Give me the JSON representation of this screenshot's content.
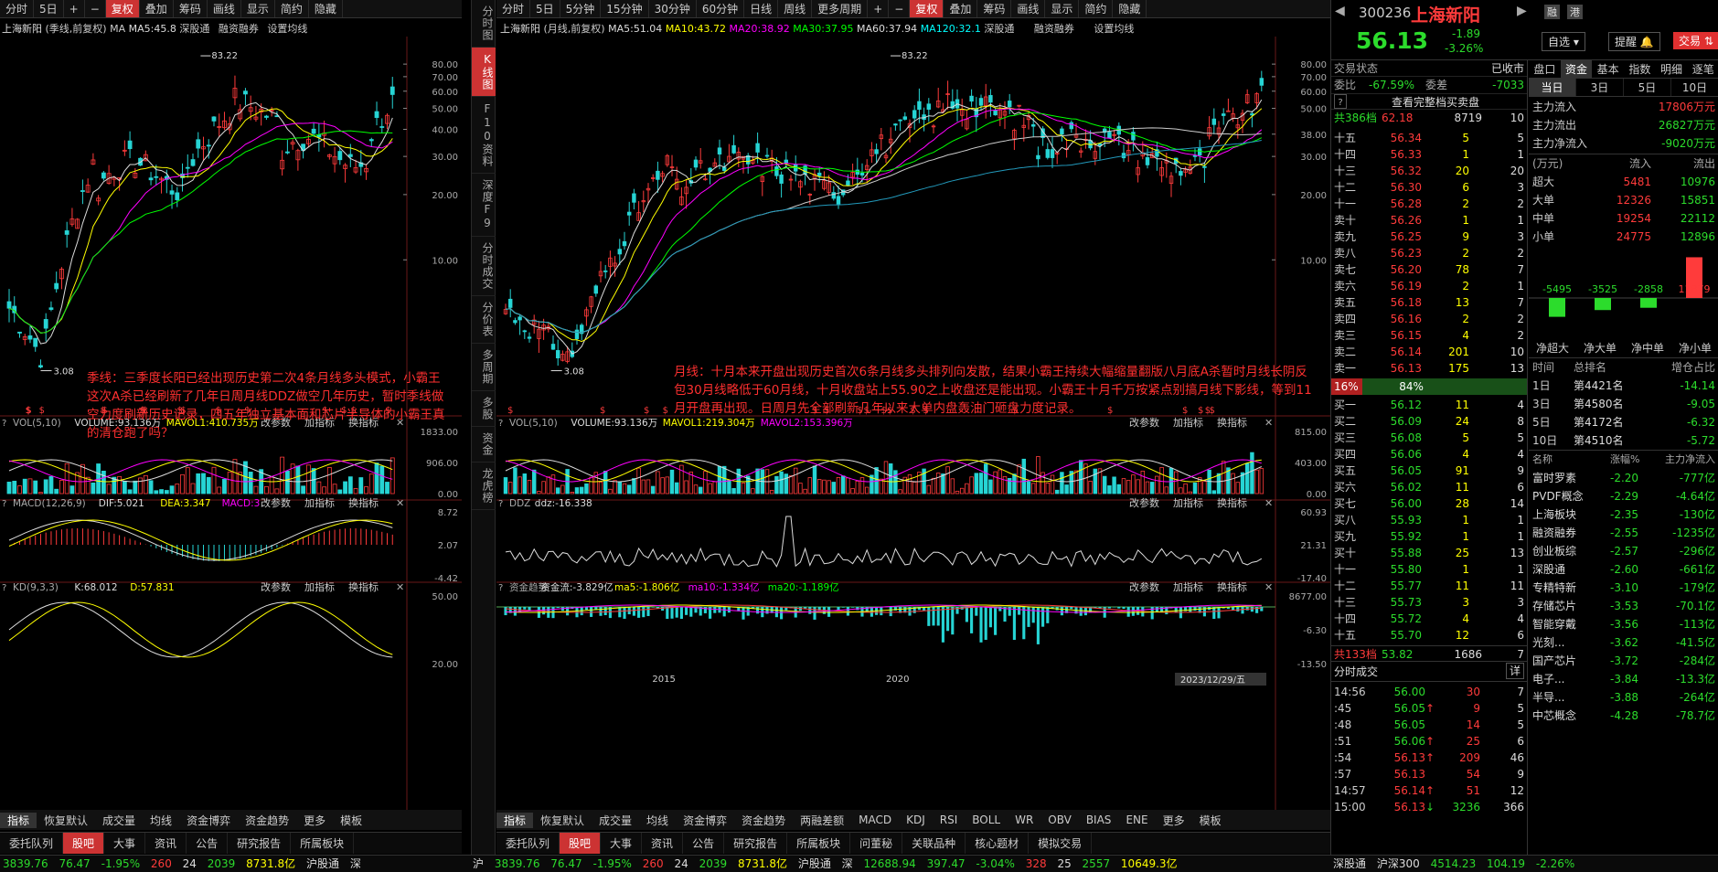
{
  "left_chart": {
    "toolbar": [
      "分时",
      "5日",
      "+",
      "−",
      "复权",
      "叠加",
      "筹码",
      "画线",
      "显示",
      "简约",
      "隐藏"
    ],
    "toolbar_active": "复权",
    "title": "上海新阳",
    "period": "(季线,前复权)",
    "ma_label": "MA",
    "ma5": "MA5:45.8",
    "extra": "深股通",
    "btn1": "融资融券",
    "btn2": "设置均线",
    "price_axis": [
      "80.00",
      "70.00",
      "60.00",
      "50.00",
      "40.00",
      "30.00",
      "20.00",
      "10.00"
    ],
    "high_label": "83.22",
    "low_label": "3.08",
    "annotation": "季线：三季度长阳已经出现历史第二次4条月线多头模式，小霸王这次A杀已经刷新了几年日周月线DDZ做空几年历史，暂时季线做空力度刷新历史记录，四五年独立基本面和芯片半导体的小霸王真的清仓跑了吗？",
    "vol_label": "VOL(5,10)",
    "vol_value": "VOLUME:93.136万",
    "vol_mavol1": "MAVOL1:410.735万",
    "vol_axis": [
      "1833.00",
      "906.00",
      "0.00"
    ],
    "macd_label": "MACD(12,26,9)",
    "macd_dif": "DIF:5.021",
    "macd_dea": "DEA:3.347",
    "macd_macd": "MACD:3",
    "macd_axis": [
      "8.72",
      "2.07",
      "-4.42"
    ],
    "kd_label": "KD(9,3,3)",
    "kd_k": "K:68.012",
    "kd_d": "D:57.831",
    "kd_axis": [
      "50.00",
      "20.00"
    ],
    "pane_btns": [
      "改参数",
      "加指标",
      "换指标"
    ],
    "bottom_tabs": [
      "指标",
      "恢复默认",
      "成交量",
      "均线",
      "资金博弈",
      "资金趋势",
      "更多",
      "模板"
    ],
    "bottom_tabs2": [
      "委托队列",
      "股吧",
      "大事",
      "资讯",
      "公告",
      "研究报告",
      "所属板块"
    ]
  },
  "vnav": [
    "分时图",
    "K线图",
    "F10资料",
    "深度F9",
    "分时成交",
    "分价表",
    "多周期",
    "多股",
    "资金",
    "龙虎榜"
  ],
  "vnav_active": "K线图",
  "mid_chart": {
    "toolbar": [
      "分时",
      "5日",
      "5分钟",
      "15分钟",
      "30分钟",
      "60分钟",
      "日线",
      "周线",
      "更多周期",
      "+",
      "−",
      "复权",
      "叠加",
      "筹码",
      "画线",
      "显示",
      "简约",
      "隐藏"
    ],
    "toolbar_active": "复权",
    "title": "上海新阳",
    "period": "(月线,前复权)",
    "ma5": "MA5:51.04",
    "ma10": "MA10:43.72",
    "ma20": "MA20:38.92",
    "ma30": "MA30:37.95",
    "ma60": "MA60:37.94",
    "ma120": "MA120:32.1",
    "extra": "深股通",
    "btn1": "融资融券",
    "btn2": "设置均线",
    "price_axis": [
      "80.00",
      "70.00",
      "60.00",
      "50.00",
      "38.00",
      "30.00",
      "20.00",
      "10.00"
    ],
    "high_label": "83.22",
    "low_label": "3.08",
    "annotation": "月线：十月本来开盘出现历史首次6条月线多头排列向发散，结果小霸王持续大幅缩量翻版八月底A杀暂时月线长阴反包30月线略低于60月线，十月收盘站上55.90之上收盘还是能出现。小霸王十月千万按紧点别搞月线下影线，等到11月开盘再出现。日周月先全部刷新几年以来大单内盘轰油门砸盘力度记录。",
    "vol_label": "VOL(5,10)",
    "vol_value": "VOLUME:93.136万",
    "vol_mavol1": "MAVOL1:219.304万",
    "vol_mavol2": "MAVOL2:153.396万",
    "vol_axis": [
      "815.00",
      "403.00",
      "0.00"
    ],
    "ddz_label": "DDZ",
    "ddz_value": "ddz:-16.338",
    "ddz_axis": [
      "60.93",
      "21.31",
      "-17.40"
    ],
    "fund_label": "资金趋势",
    "fund_value": "资金流:-3.829亿",
    "fund_ma5": "ma5:-1.806亿",
    "fund_ma10": "ma10:-1.334亿",
    "fund_ma20": "ma20:-1.189亿",
    "fund_axis": [
      "8677.00",
      "-6.30",
      "-13.50"
    ],
    "x_labels": [
      "2015",
      "2020"
    ],
    "date_box": "2023/12/29/五",
    "pane_btns": [
      "改参数",
      "加指标",
      "换指标"
    ],
    "bottom_tabs": [
      "指标",
      "恢复默认",
      "成交量",
      "均线",
      "资金博弈",
      "资金趋势",
      "两融差额",
      "MACD",
      "KDJ",
      "RSI",
      "BOLL",
      "WR",
      "OBV",
      "BIAS",
      "ENE",
      "更多",
      "模板"
    ],
    "bottom_tabs2": [
      "委托队列",
      "股吧",
      "大事",
      "资讯",
      "公告",
      "研究报告",
      "所属板块",
      "问董秘",
      "关联品种",
      "核心题材",
      "模拟交易"
    ]
  },
  "right_panel": {
    "code": "300236",
    "name": "上海新阳",
    "badge1": "融",
    "badge2": "港",
    "price": "56.13",
    "change": "-1.89",
    "change_pct": "-3.26%",
    "btn_watch": "自选",
    "btn_alert": "提醒",
    "btn_trade": "交易",
    "trade_status_label": "交易状态",
    "trade_status": "已收市",
    "weibi_label": "委比",
    "weibi": "-67.59%",
    "weicha_label": "委差",
    "weicha": "-7033",
    "full_book": "查看完整档买卖盘",
    "sell_total_label": "共386档",
    "sell_total_price": "62.18",
    "sell_total_vol": "8719",
    "sell_total_cnt": "10",
    "sells": [
      {
        "l": "十五",
        "p": "56.34",
        "v": "5",
        "c": "5"
      },
      {
        "l": "十四",
        "p": "56.33",
        "v": "1",
        "c": "1"
      },
      {
        "l": "十三",
        "p": "56.32",
        "v": "20",
        "c": "20"
      },
      {
        "l": "十二",
        "p": "56.30",
        "v": "6",
        "c": "3"
      },
      {
        "l": "十一",
        "p": "56.28",
        "v": "2",
        "c": "2"
      },
      {
        "l": "卖十",
        "p": "56.26",
        "v": "1",
        "c": "1"
      },
      {
        "l": "卖九",
        "p": "56.25",
        "v": "9",
        "c": "3"
      },
      {
        "l": "卖八",
        "p": "56.23",
        "v": "2",
        "c": "2"
      },
      {
        "l": "卖七",
        "p": "56.20",
        "v": "78",
        "c": "7"
      },
      {
        "l": "卖六",
        "p": "56.19",
        "v": "2",
        "c": "1"
      },
      {
        "l": "卖五",
        "p": "56.18",
        "v": "13",
        "c": "7"
      },
      {
        "l": "卖四",
        "p": "56.16",
        "v": "2",
        "c": "2"
      },
      {
        "l": "卖三",
        "p": "56.15",
        "v": "4",
        "c": "2"
      },
      {
        "l": "卖二",
        "p": "56.14",
        "v": "201",
        "c": "10"
      },
      {
        "l": "卖一",
        "p": "56.13",
        "v": "175",
        "c": "13"
      }
    ],
    "ratio_left": "16%",
    "ratio_right": "84%",
    "buys": [
      {
        "l": "买一",
        "p": "56.12",
        "v": "11",
        "c": "4"
      },
      {
        "l": "买二",
        "p": "56.09",
        "v": "24",
        "c": "8"
      },
      {
        "l": "买三",
        "p": "56.08",
        "v": "5",
        "c": "5"
      },
      {
        "l": "买四",
        "p": "56.06",
        "v": "4",
        "c": "4"
      },
      {
        "l": "买五",
        "p": "56.05",
        "v": "91",
        "c": "9"
      },
      {
        "l": "买六",
        "p": "56.02",
        "v": "11",
        "c": "6"
      },
      {
        "l": "买七",
        "p": "56.00",
        "v": "28",
        "c": "14"
      },
      {
        "l": "买八",
        "p": "55.93",
        "v": "1",
        "c": "1"
      },
      {
        "l": "买九",
        "p": "55.92",
        "v": "1",
        "c": "1"
      },
      {
        "l": "买十",
        "p": "55.88",
        "v": "25",
        "c": "13"
      },
      {
        "l": "十一",
        "p": "55.80",
        "v": "1",
        "c": "1"
      },
      {
        "l": "十二",
        "p": "55.77",
        "v": "11",
        "c": "11"
      },
      {
        "l": "十三",
        "p": "55.73",
        "v": "3",
        "c": "3"
      },
      {
        "l": "十四",
        "p": "55.72",
        "v": "4",
        "c": "4"
      },
      {
        "l": "十五",
        "p": "55.70",
        "v": "12",
        "c": "6"
      }
    ],
    "buy_total_label": "共133档",
    "buy_total_price": "53.82",
    "buy_total_vol": "1686",
    "buy_total_cnt": "7",
    "ticks_title": "分时成交",
    "ticks_more": "详",
    "ticks": [
      {
        "t": "14:56",
        "p": "56.00",
        "v": "30",
        "n": "7",
        "d": ""
      },
      {
        "t": ":45",
        "p": "56.05",
        "v": "9",
        "n": "5",
        "d": "↑"
      },
      {
        "t": ":48",
        "p": "56.05",
        "v": "14",
        "n": "5",
        "d": ""
      },
      {
        "t": ":51",
        "p": "56.06",
        "v": "25",
        "n": "6",
        "d": "↑"
      },
      {
        "t": ":54",
        "p": "56.13",
        "v": "209",
        "n": "46",
        "d": "↑"
      },
      {
        "t": ":57",
        "p": "56.13",
        "v": "54",
        "n": "9",
        "d": ""
      },
      {
        "t": "14:57",
        "p": "56.14",
        "v": "51",
        "n": "12",
        "d": "↑"
      },
      {
        "t": "15:00",
        "p": "56.13",
        "v": "3236",
        "n": "366",
        "d": "↓"
      }
    ],
    "tabs": [
      "盘口",
      "资金",
      "基本",
      "指数",
      "明细",
      "逐笔"
    ],
    "tabs_active": "资金",
    "period_tabs": [
      "当日",
      "3日",
      "5日",
      "10日"
    ],
    "main_in_label": "主力流入",
    "main_in": "17806万元",
    "main_out_label": "主力流出",
    "main_out": "26827万元",
    "main_net_label": "主力净流入",
    "main_net": "-9020万元",
    "flow_head": [
      "(万元)",
      "流入",
      "流出"
    ],
    "flows": [
      {
        "n": "超大",
        "i": "5481",
        "o": "10976"
      },
      {
        "n": "大单",
        "i": "12326",
        "o": "15851"
      },
      {
        "n": "中单",
        "i": "19254",
        "o": "22112"
      },
      {
        "n": "小单",
        "i": "24775",
        "o": "12896"
      }
    ],
    "net_bars": [
      {
        "label": "净超大",
        "value": "-5495",
        "num": -5495
      },
      {
        "label": "净大单",
        "value": "-3525",
        "num": -3525
      },
      {
        "label": "净中单",
        "value": "-2858",
        "num": -2858
      },
      {
        "label": "净小单",
        "value": "11879",
        "num": 11879
      }
    ],
    "rank_head": [
      "时间",
      "总排名",
      "增仓占比"
    ],
    "ranks": [
      {
        "t": "1日",
        "r": "第4421名",
        "v": "-14.14"
      },
      {
        "t": "3日",
        "r": "第4580名",
        "v": "-9.05"
      },
      {
        "t": "5日",
        "r": "第4172名",
        "v": "-6.32"
      },
      {
        "t": "10日",
        "r": "第4510名",
        "v": "-5.72"
      }
    ],
    "sector_head": [
      "名称",
      "涨幅%",
      "主力净流入"
    ],
    "sectors": [
      {
        "n": "富时罗素",
        "p": "-2.20",
        "v": "-777亿"
      },
      {
        "n": "PVDF概念",
        "p": "-2.29",
        "v": "-4.64亿"
      },
      {
        "n": "上海板块",
        "p": "-2.35",
        "v": "-130亿"
      },
      {
        "n": "融资融券",
        "p": "-2.55",
        "v": "-1235亿"
      },
      {
        "n": "创业板综",
        "p": "-2.57",
        "v": "-296亿"
      },
      {
        "n": "深股通",
        "p": "-2.60",
        "v": "-661亿"
      },
      {
        "n": "专精特新",
        "p": "-3.10",
        "v": "-179亿"
      },
      {
        "n": "存储芯片",
        "p": "-3.53",
        "v": "-70.1亿"
      },
      {
        "n": "智能穿戴",
        "p": "-3.56",
        "v": "-113亿"
      },
      {
        "n": "光刻...",
        "p": "-3.62",
        "v": "-41.5亿"
      },
      {
        "n": "国产芯片",
        "p": "-3.72",
        "v": "-284亿"
      },
      {
        "n": "电子...",
        "p": "-3.84",
        "v": "-13.3亿"
      },
      {
        "n": "半导...",
        "p": "-3.88",
        "v": "-264亿"
      },
      {
        "n": "中芯概念",
        "p": "-4.28",
        "v": "-78.7亿"
      }
    ]
  },
  "status_bar": {
    "s1": "3839.76",
    "s2": "76.47",
    "s3": "-1.95%",
    "s4": "260",
    "s5": "24",
    "s6": "2039",
    "s7": "8731.8亿",
    "s8": "沪股通",
    "s9": "深",
    "m1": "沪",
    "m2": "3839.76",
    "m3": "76.47",
    "m4": "-1.95%",
    "m5": "260",
    "m6": "24",
    "m7": "2039",
    "m8": "8731.8亿",
    "m9": "沪股通",
    "m10": "深",
    "m11": "12688.94",
    "m12": "397.47",
    "m13": "-3.04%",
    "m14": "328",
    "m15": "25",
    "m16": "2557",
    "m17": "10649.3亿",
    "r1": "深股通",
    "r2": "沪深300",
    "r3": "4514.23",
    "r4": "104.19",
    "r5": "-2.26%"
  }
}
